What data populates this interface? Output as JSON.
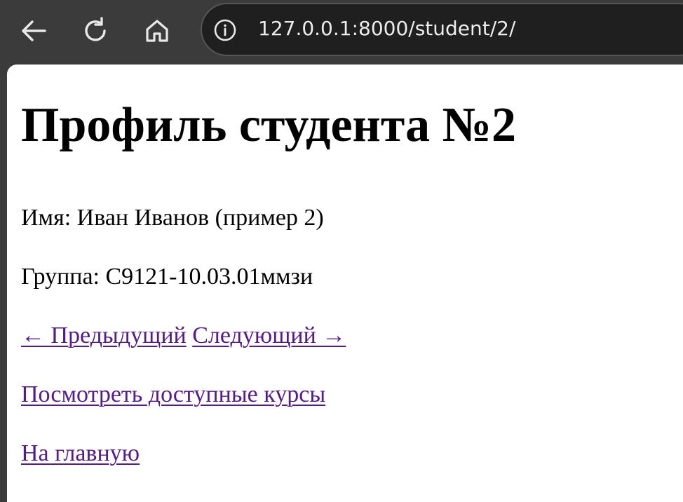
{
  "browser": {
    "url": "127.0.0.1:8000/student/2/",
    "icons": {
      "back": "arrow-left-icon",
      "reload": "reload-icon",
      "home": "home-icon",
      "site_info": "info-icon"
    },
    "colors": {
      "toolbar_bg": "#3b3b3b",
      "address_bg": "#1f1f1f",
      "visited_link": "#551a8b"
    }
  },
  "page": {
    "title": "Профиль студента №2",
    "name_label": "Имя:",
    "name_value": "Иван Иванов (пример 2)",
    "group_label": "Группа:",
    "group_value": "С9121-10.03.01ммзи",
    "prev_link": "← Предыдущий",
    "next_link": "Следующий →",
    "courses_link": "Посмотреть доступные курсы",
    "home_link": "На главную"
  }
}
